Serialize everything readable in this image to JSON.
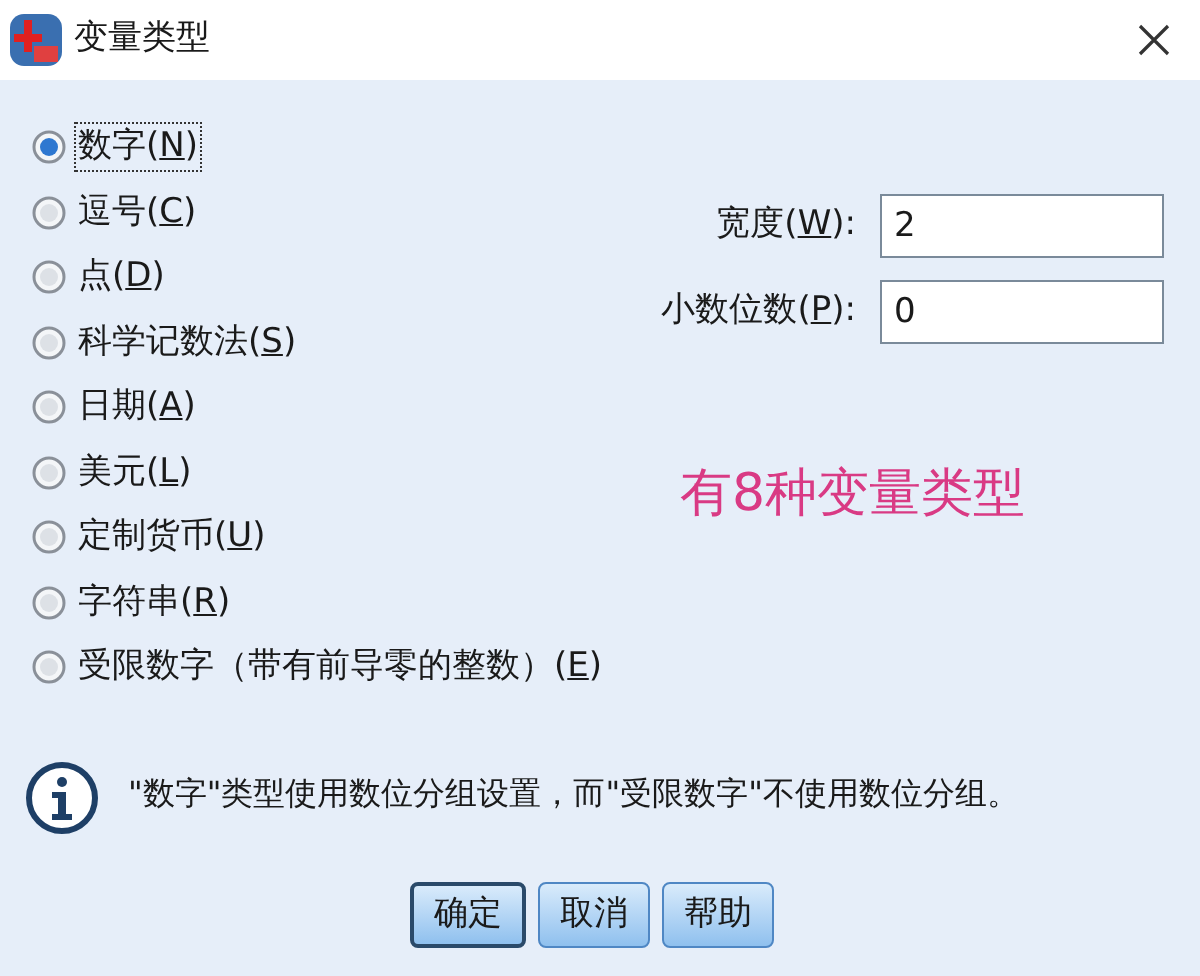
{
  "window": {
    "title": "变量类型"
  },
  "types": [
    {
      "label": "数字(N)",
      "selected": true
    },
    {
      "label": "逗号(C)",
      "selected": false
    },
    {
      "label": "点(D)",
      "selected": false
    },
    {
      "label": "科学记数法(S)",
      "selected": false
    },
    {
      "label": "日期(A)",
      "selected": false
    },
    {
      "label": "美元(L)",
      "selected": false
    },
    {
      "label": "定制货币(U)",
      "selected": false
    },
    {
      "label": "字符串(R)",
      "selected": false
    },
    {
      "label": "受限数字（带有前导零的整数）(E)",
      "selected": false
    }
  ],
  "fields": [
    {
      "label": "宽度(W):",
      "value": "2"
    },
    {
      "label": "小数位数(P):",
      "value": "0"
    }
  ],
  "annotation": "有8种变量类型",
  "info": "\"数字\"类型使用数位分组设置，而\"受限数字\"不使用数位分组。",
  "buttons": [
    {
      "label": "确定",
      "default": true
    },
    {
      "label": "取消",
      "default": false
    },
    {
      "label": "帮助",
      "default": false
    }
  ]
}
